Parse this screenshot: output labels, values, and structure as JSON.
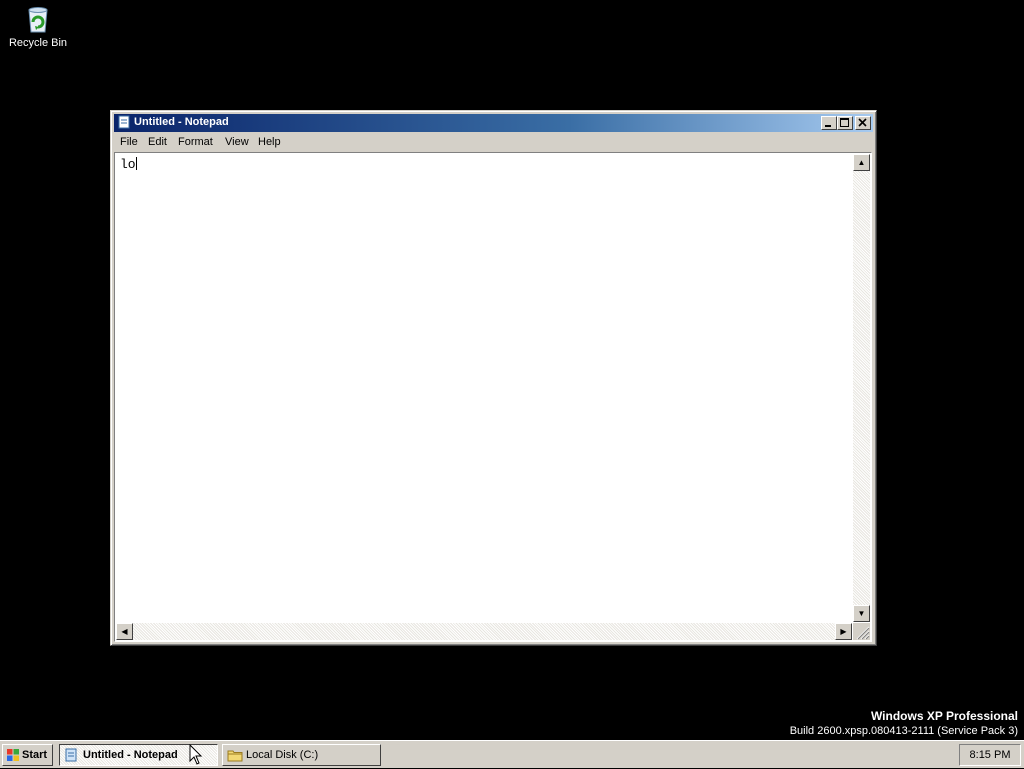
{
  "desktop": {
    "icons": [
      {
        "label": "Recycle Bin",
        "icon": "recycle-bin-icon"
      }
    ]
  },
  "window": {
    "title": "Untitled - Notepad",
    "app_icon": "notepad-icon",
    "controls": {
      "minimize": "minimize-icon",
      "maximize": "maximize-icon",
      "close": "close-icon"
    },
    "menu": [
      "File",
      "Edit",
      "Format",
      "View",
      "Help"
    ],
    "editor_text": "lo",
    "colors": {
      "title_active_start": "#0a246a",
      "title_active_end": "#a6caf0",
      "face": "#d4d0c8"
    }
  },
  "watermark": {
    "line1": "Windows XP Professional",
    "line2": "Build 2600.xpsp.080413-2111 (Service Pack 3)"
  },
  "taskbar": {
    "start_label": "Start",
    "tasks": [
      {
        "label": "Untitled - Notepad",
        "icon": "notepad-icon",
        "active": true
      },
      {
        "label": "Local Disk (C:)",
        "icon": "folder-icon",
        "active": false
      }
    ],
    "clock": "8:15 PM"
  }
}
